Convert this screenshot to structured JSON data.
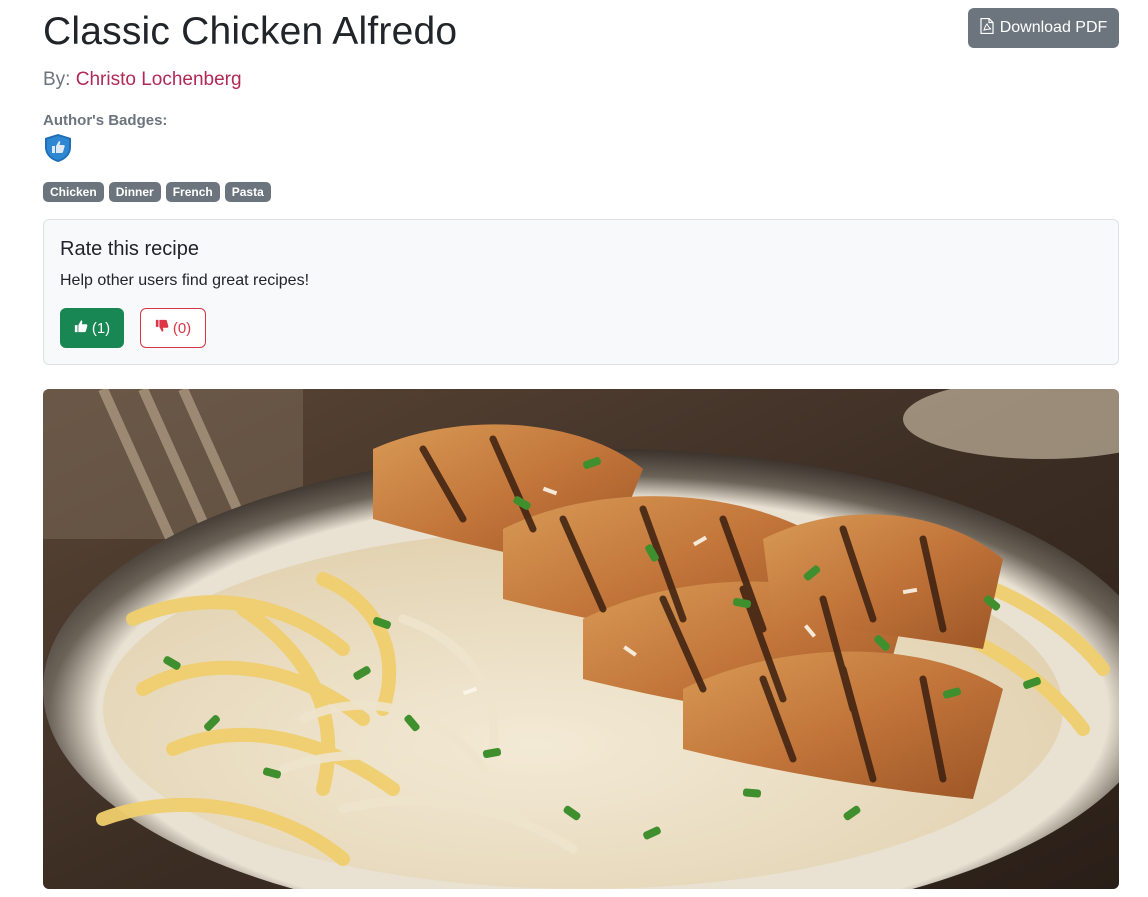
{
  "recipe": {
    "title": "Classic Chicken Alfredo",
    "by_label": "By:",
    "author": "Christo Lochenberg"
  },
  "actions": {
    "download_pdf": "Download PDF"
  },
  "badges": {
    "label": "Author's Badges:",
    "items": [
      {
        "icon": "thumbs-up-shield-icon"
      }
    ]
  },
  "tags": [
    "Chicken",
    "Dinner",
    "French",
    "Pasta"
  ],
  "rating": {
    "title": "Rate this recipe",
    "subtitle": "Help other users find great recipes!",
    "upvotes": "(1)",
    "downvotes": "(0)"
  },
  "colors": {
    "author_link": "#b02a55",
    "secondary": "#6c757d",
    "success": "#198754",
    "danger": "#dc3545"
  },
  "image": {
    "alt": "Classic Chicken Alfredo"
  }
}
